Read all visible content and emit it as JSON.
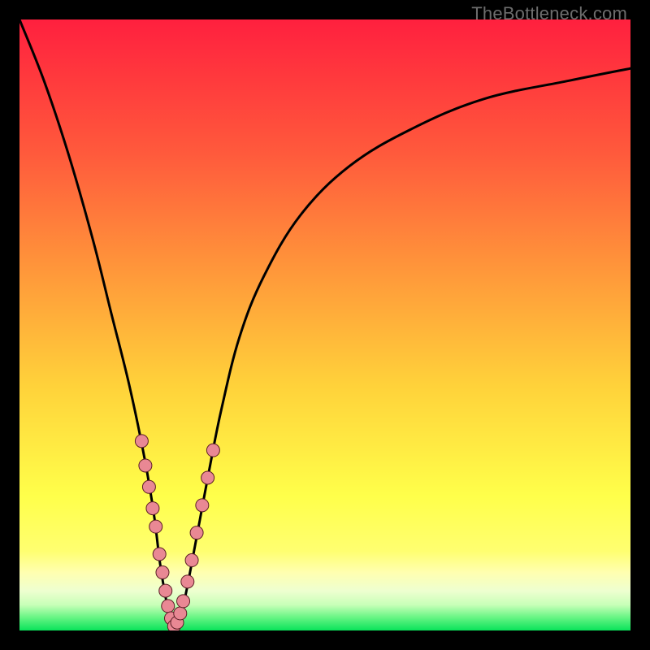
{
  "watermark": "TheBottleneck.com",
  "colors": {
    "bg_black": "#000000",
    "grad_top": "#ff203e",
    "grad_mid_upper": "#ff7a3a",
    "grad_mid": "#ffd63a",
    "grad_lower": "#ffff52",
    "grad_pale": "#f3ffb0",
    "grad_green": "#09e35a",
    "curve_stroke": "#000000",
    "marker_fill": "#e98894",
    "marker_stroke": "#5b1e25"
  },
  "chart_data": {
    "type": "line",
    "title": "",
    "xlabel": "",
    "ylabel": "",
    "xlim": [
      0,
      100
    ],
    "ylim": [
      0,
      100
    ],
    "series": [
      {
        "name": "bottleneck-curve",
        "x": [
          0,
          4,
          8,
          12,
          15,
          18,
          20.5,
          22,
          23,
          24,
          24.8,
          25.3,
          26,
          27,
          28,
          29.5,
          31,
          33,
          36,
          40,
          46,
          54,
          64,
          76,
          90,
          100
        ],
        "y": [
          100,
          90,
          78,
          64,
          52,
          40,
          28,
          19,
          11,
          5,
          1.5,
          0.5,
          1.5,
          5,
          10,
          18,
          26,
          36,
          48,
          58,
          68,
          76,
          82,
          87,
          90,
          92
        ]
      }
    ],
    "markers": {
      "name": "highlighted-segments",
      "points": [
        {
          "x": 20.0,
          "y": 31
        },
        {
          "x": 20.6,
          "y": 27
        },
        {
          "x": 21.2,
          "y": 23.5
        },
        {
          "x": 21.8,
          "y": 20
        },
        {
          "x": 22.3,
          "y": 17
        },
        {
          "x": 22.9,
          "y": 12.5
        },
        {
          "x": 23.4,
          "y": 9.5
        },
        {
          "x": 23.9,
          "y": 6.5
        },
        {
          "x": 24.3,
          "y": 4
        },
        {
          "x": 24.8,
          "y": 2
        },
        {
          "x": 25.3,
          "y": 0.7
        },
        {
          "x": 25.8,
          "y": 1.3
        },
        {
          "x": 26.3,
          "y": 2.8
        },
        {
          "x": 26.8,
          "y": 4.8
        },
        {
          "x": 27.5,
          "y": 8
        },
        {
          "x": 28.2,
          "y": 11.5
        },
        {
          "x": 29.0,
          "y": 16
        },
        {
          "x": 29.9,
          "y": 20.5
        },
        {
          "x": 30.8,
          "y": 25
        },
        {
          "x": 31.7,
          "y": 29.5
        }
      ],
      "radius": 8
    }
  }
}
